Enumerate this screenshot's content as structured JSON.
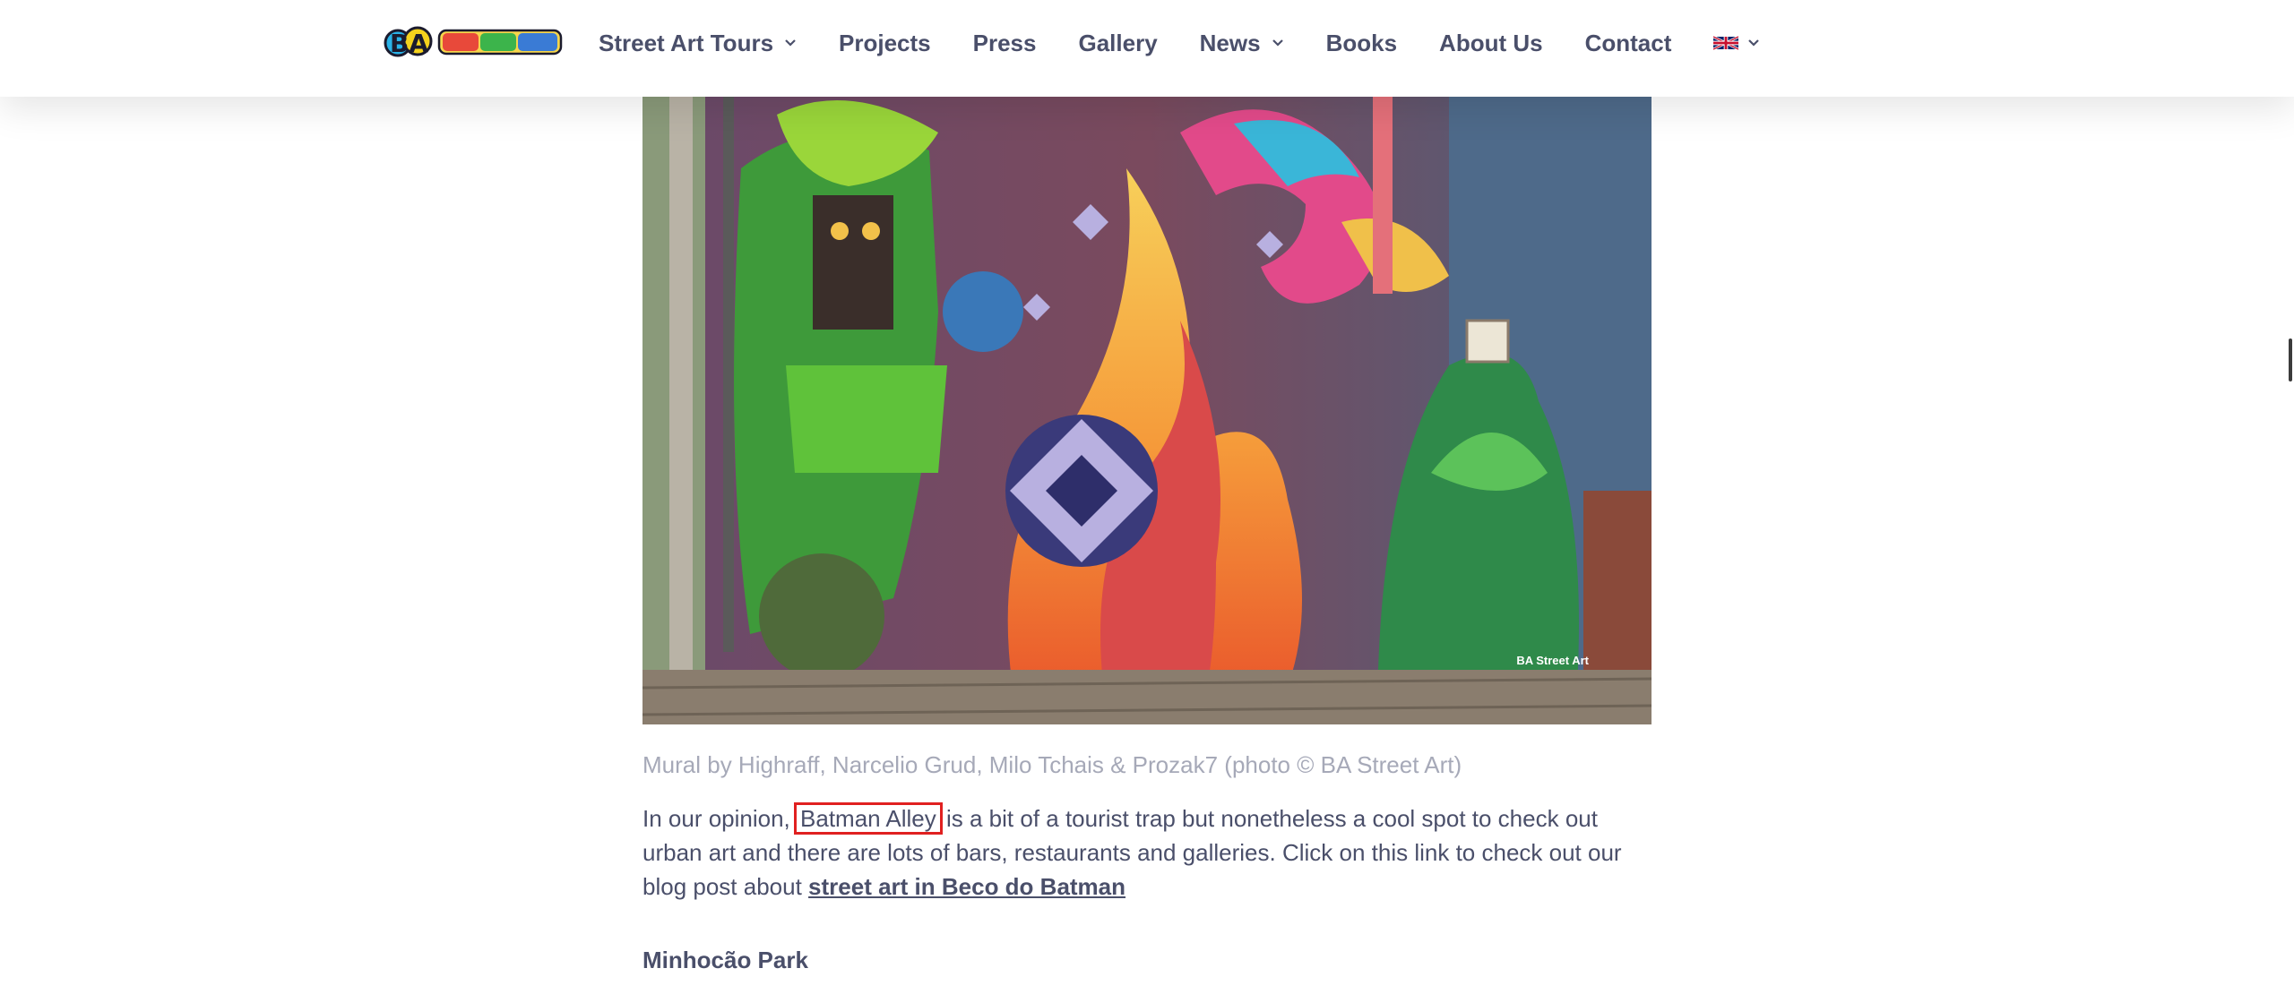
{
  "header": {
    "logo_text": "BA STREET ART",
    "nav": [
      {
        "label": "Street Art Tours",
        "dropdown": true
      },
      {
        "label": "Projects",
        "dropdown": false
      },
      {
        "label": "Press",
        "dropdown": false
      },
      {
        "label": "Gallery",
        "dropdown": false
      },
      {
        "label": "News",
        "dropdown": true
      },
      {
        "label": "Books",
        "dropdown": false
      },
      {
        "label": "About Us",
        "dropdown": false
      },
      {
        "label": "Contact",
        "dropdown": false
      }
    ],
    "language_icon": "uk-flag-icon"
  },
  "article": {
    "photo_watermark": "BA Street Art",
    "caption": "Mural by Highraff, Narcelio Grud, Milo Tchais & Prozak7 (photo © BA Street Art)",
    "para_before": "In our opinion, ",
    "highlight": "Batman Alley",
    "para_after": " is a bit of a tourist trap but nonetheless a cool spot to check out urban art and there are lots of bars, restaurants and galleries. Click on this link to check out our blog post about ",
    "link_text": "street art in Beco do Batman",
    "subheading": "Minhocão Park"
  },
  "colors": {
    "text": "#4a4f6a",
    "caption": "#a6a9b8",
    "highlight_border": "#e02020"
  }
}
